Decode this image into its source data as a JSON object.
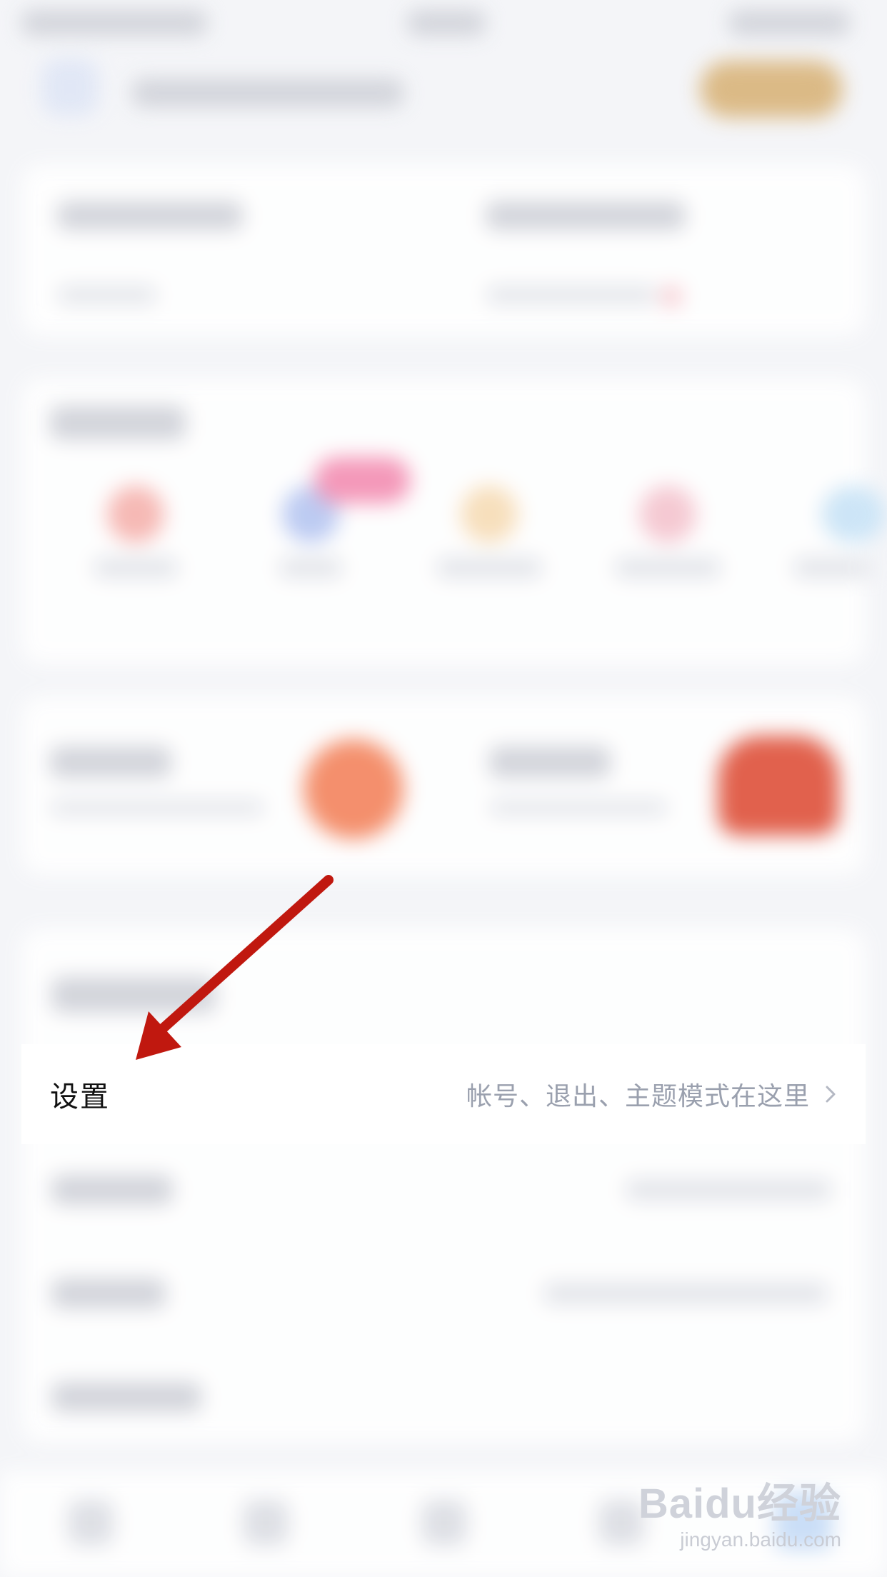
{
  "settings_row": {
    "title": "设置",
    "description": "帐号、退出、主题模式在这里"
  },
  "icons": {
    "chevron": "chevron-right-icon"
  },
  "annotation": {
    "arrow_color": "#c0180f"
  },
  "watermark": {
    "brand": "Baidu经验",
    "url": "jingyan.baidu.com"
  },
  "colors": {
    "background": "#f4f5f8",
    "row_background": "#ffffff",
    "title_text": "#111111",
    "description_text": "#9aa0ae",
    "accent_gold": "#d9b47a",
    "accent_orange": "#f5855e",
    "accent_red": "#e0523b",
    "accent_pink": "#f58fb3"
  }
}
